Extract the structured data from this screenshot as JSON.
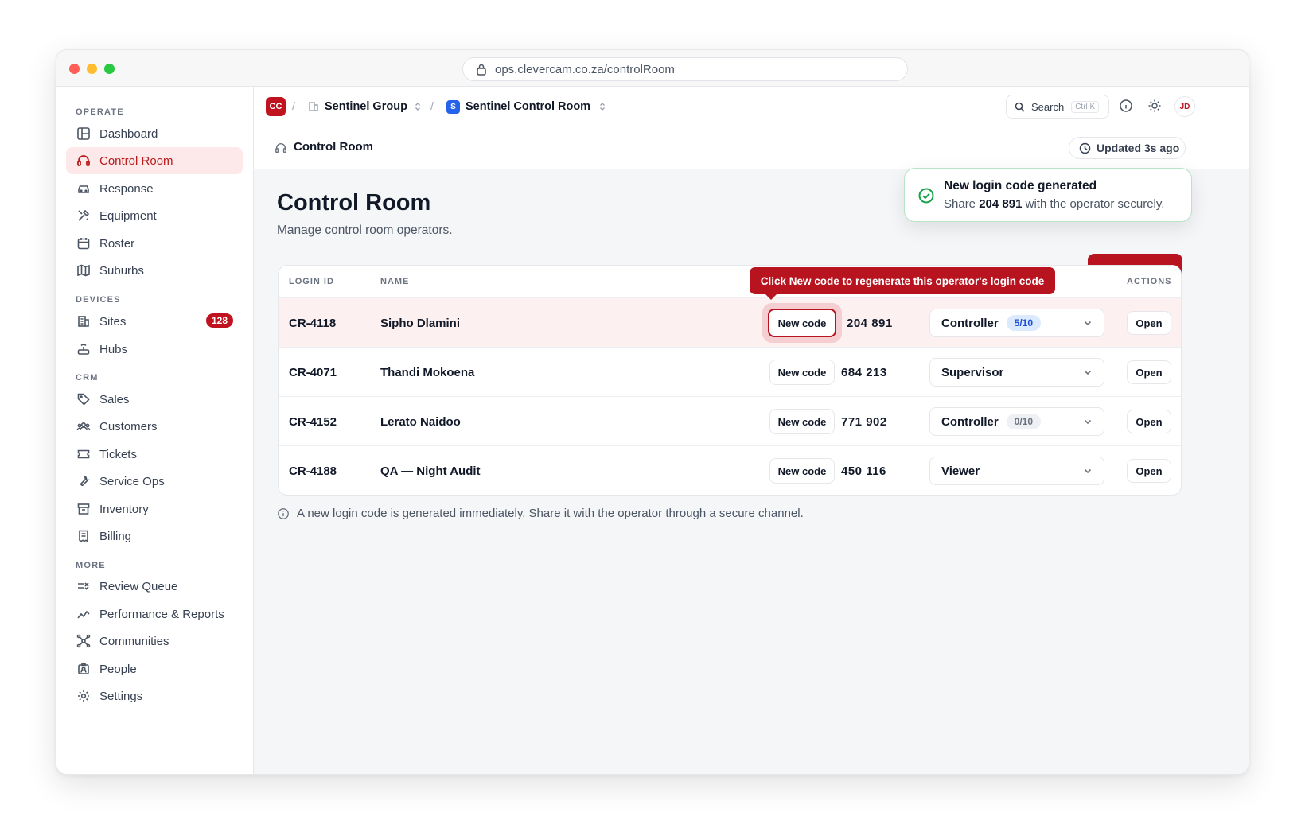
{
  "browser": {
    "url": "ops.clevercam.co.za/controlRoom"
  },
  "sidebar": {
    "sections": {
      "operate": "OPERATE",
      "devices": "DEVICES",
      "crm": "CRM",
      "more": "MORE"
    },
    "items": {
      "dashboard": "Dashboard",
      "control_room": "Control Room",
      "response": "Response",
      "equipment": "Equipment",
      "roster": "Roster",
      "suburbs": "Suburbs",
      "sites": "Sites",
      "sites_badge": "128",
      "hubs": "Hubs",
      "sales": "Sales",
      "customers": "Customers",
      "tickets": "Tickets",
      "service_ops": "Service Ops",
      "inventory": "Inventory",
      "billing": "Billing",
      "review_queue": "Review Queue",
      "performance": "Performance & Reports",
      "communities": "Communities",
      "people": "People",
      "settings": "Settings"
    }
  },
  "topbar": {
    "org_initials": "CC",
    "org_name": "Sentinel Group",
    "workspace_initial": "S",
    "workspace_name": "Sentinel Control Room",
    "search_label": "Search",
    "search_shortcut": "Ctrl K",
    "avatar_initials": "JD"
  },
  "subbar": {
    "title": "Control Room",
    "updated": "Updated 3s ago"
  },
  "page": {
    "title": "Control Room",
    "subtitle": "Manage control room operators.",
    "footer_note": "A new login code is generated immediately. Share it with the operator through a secure channel."
  },
  "table": {
    "headers": {
      "login_id": "LOGIN ID",
      "name": "NAME",
      "actions": "ACTIONS"
    },
    "new_code_label": "New code",
    "open_label": "Open",
    "rows": [
      {
        "login_id": "CR-4118",
        "name": "Sipho Dlamini",
        "code": "204 891",
        "role": "Controller",
        "pill": "5/10"
      },
      {
        "login_id": "CR-4071",
        "name": "Thandi Mokoena",
        "code": "684 213",
        "role": "Supervisor",
        "pill": ""
      },
      {
        "login_id": "CR-4152",
        "name": "Lerato Naidoo",
        "code": "771 902",
        "role": "Controller",
        "pill": "0/10"
      },
      {
        "login_id": "CR-4188",
        "name": "QA — Night Audit",
        "code": "450 116",
        "role": "Viewer",
        "pill": ""
      }
    ]
  },
  "tooltip": {
    "text": "Click New code to regenerate this operator's login code"
  },
  "toast": {
    "title": "New login code generated",
    "prefix": "Share",
    "code": "204 891",
    "suffix": "with the operator securely."
  },
  "colors": {
    "brand": "#b81420",
    "success": "#16a34a",
    "pill_blue_bg": "#dbeafe",
    "pill_blue_fg": "#1d4ed8"
  }
}
